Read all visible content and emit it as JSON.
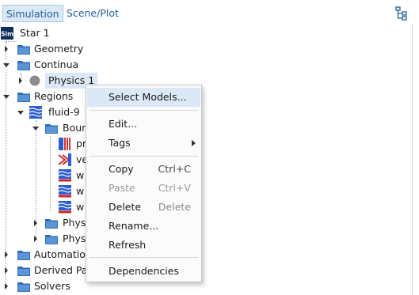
{
  "tabs": [
    {
      "label": "Simulation",
      "active": true
    },
    {
      "label": "Scene/Plot",
      "active": false
    }
  ],
  "tree": {
    "root": "Star 1",
    "geometry": "Geometry",
    "continua": "Continua",
    "physics1": "Physics 1",
    "regions": "Regions",
    "fluid": "fluid-9",
    "boundaries": "Boun",
    "b1": "pr",
    "b2": "ve",
    "b3": "w",
    "b4": "w",
    "b5": "w",
    "phys_a": "Phys",
    "phys_b": "Phys",
    "automation": "Automatio",
    "derived": "Derived Pa",
    "solvers": "Solvers"
  },
  "context_menu": {
    "select_models": "Select Models...",
    "edit": "Edit...",
    "tags": "Tags",
    "copy": "Copy",
    "copy_key": "Ctrl+C",
    "paste": "Paste",
    "paste_key": "Ctrl+V",
    "delete": "Delete",
    "delete_key": "Delete",
    "rename": "Rename...",
    "refresh": "Refresh",
    "dependencies": "Dependencies"
  },
  "colors": {
    "selection": "#dbe8f5",
    "folder": "#2f6fb8",
    "region": "#2b5fd0"
  },
  "icons": {
    "root": "sim-icon",
    "folder": "folder-icon",
    "physics": "physics-continuum-icon",
    "region": "region-icon",
    "boundary": "boundary-icon",
    "tree_view": "tree-view-icon"
  }
}
